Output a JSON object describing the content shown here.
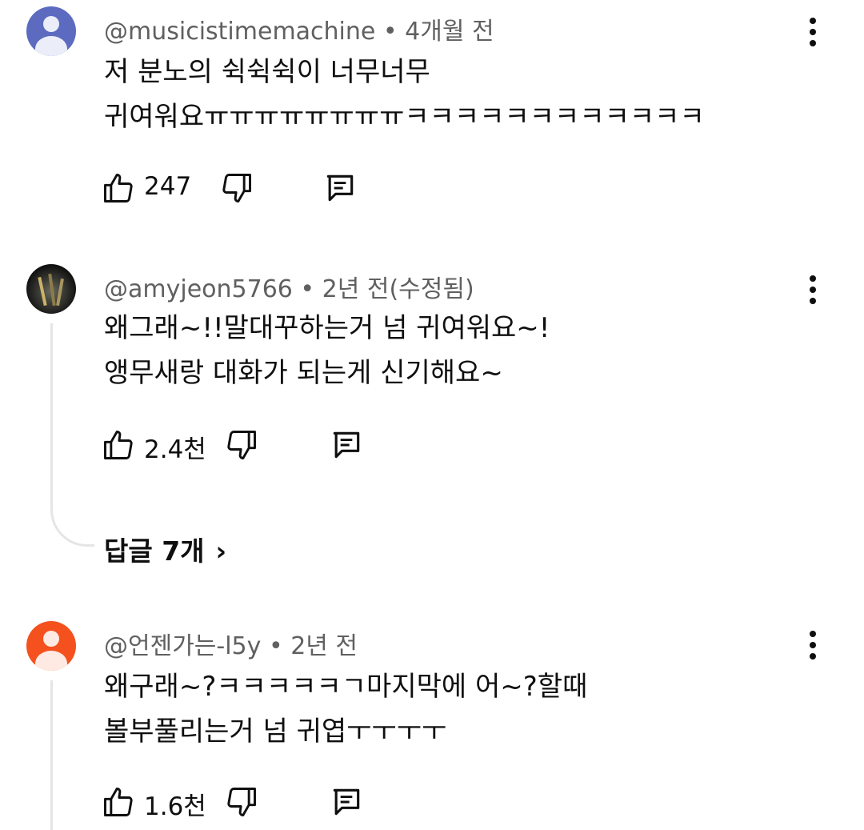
{
  "comments": [
    {
      "author": "@musicistimemachine",
      "time": "4개월 전",
      "lines": [
        "저 분노의 쉭쉭쉭이 너무너무",
        "귀여워요ㅠㅠㅠㅠㅠㅠㅠㅠㅋㅋㅋㅋㅋㅋㅋㅋㅋㅋㅋㅋ"
      ],
      "likes": "247",
      "avatar": "default-avatar"
    },
    {
      "author": "@amyjeon5766",
      "time": "2년 전(수정됨)",
      "lines": [
        "왜그래~!!말대꾸하는거 넘 귀여워요~!",
        "앵무새랑 대화가 되는게 신기해요~"
      ],
      "likes": "2.4천",
      "avatar": "photo-avatar",
      "replies": "답글 7개"
    },
    {
      "author": "@언젠가는-l5y",
      "time": "2년 전",
      "lines": [
        "왜구래~?ㅋㅋㅋㅋㅋㄱ마지막에 어~?할때",
        "볼부풀리는거 넘 귀엽ㅜㅜㅜㅜ"
      ],
      "likes": "1.6천",
      "avatar": "default-avatar"
    }
  ],
  "separator": " • ",
  "icons": {
    "like": "thumbs-up-icon",
    "dislike": "thumbs-down-icon",
    "reply": "comment-icon",
    "more": "more-vertical-icon",
    "expand": "chevron-right-icon"
  },
  "colors": {
    "avatar_blue": "#5c6bc0",
    "avatar_orange": "#f4511e",
    "meta_gray": "#606060"
  }
}
